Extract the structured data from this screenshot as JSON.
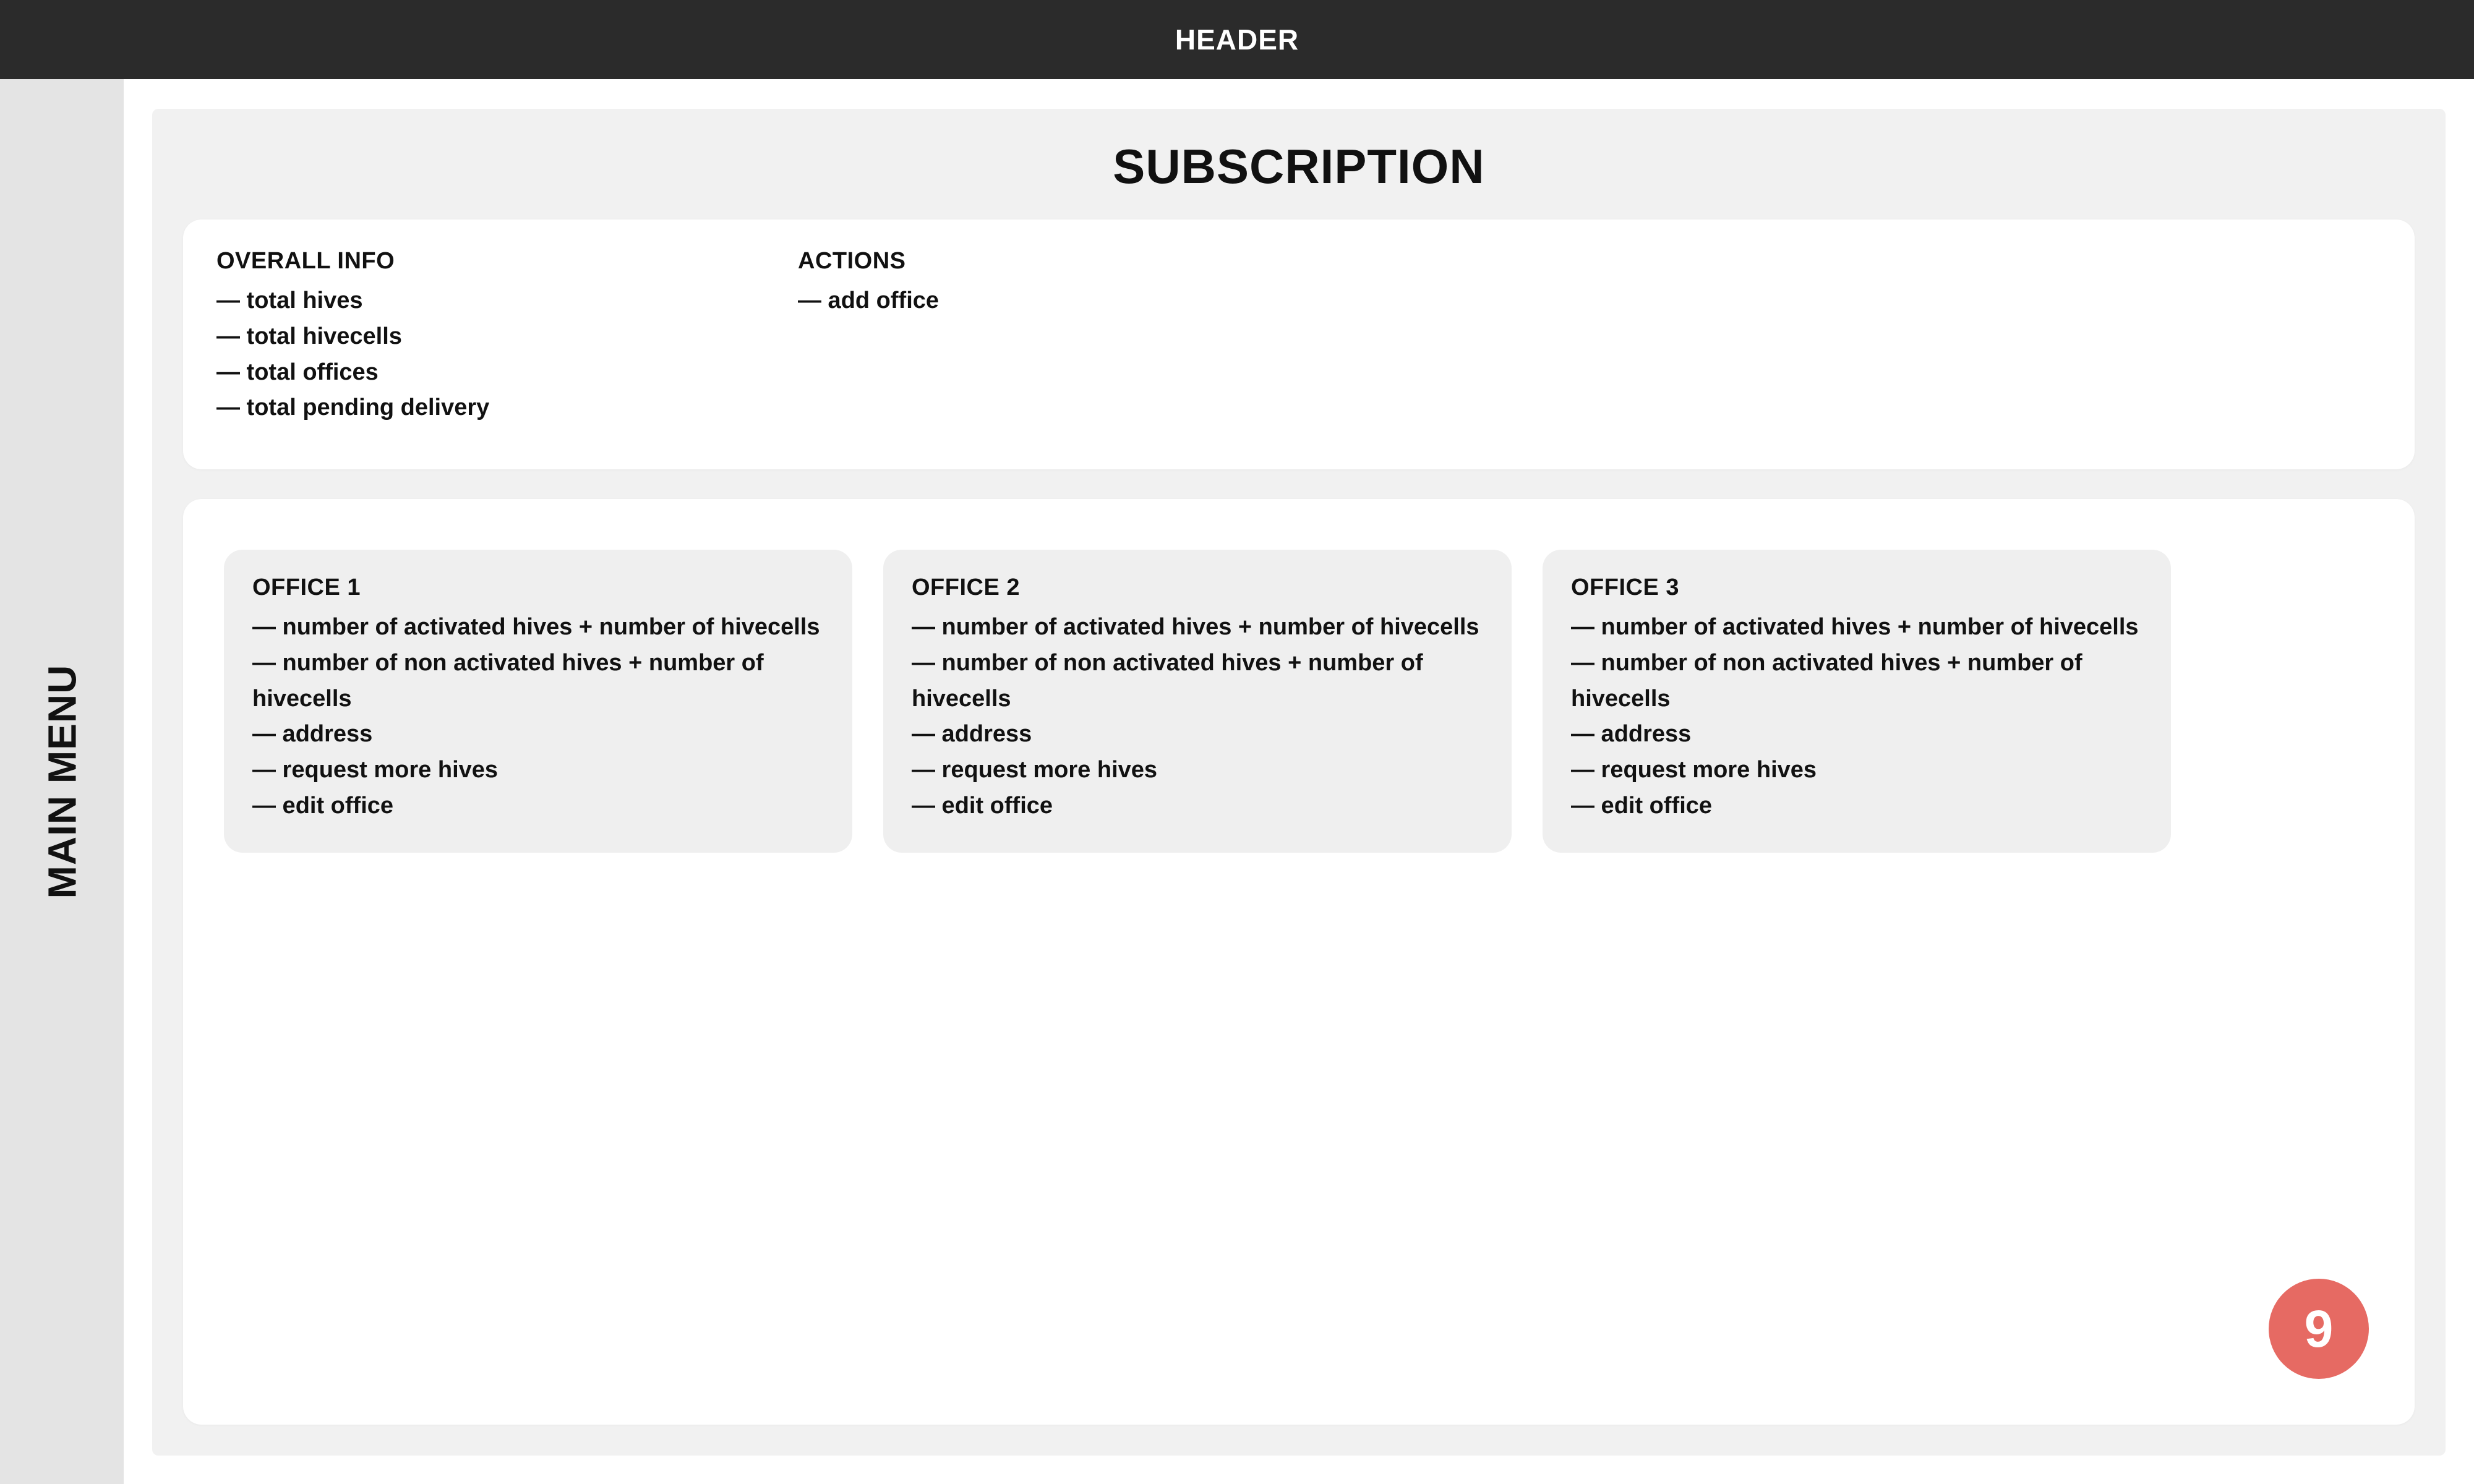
{
  "header": {
    "title": "HEADER"
  },
  "sidebar": {
    "label": "MAIN MENU"
  },
  "page": {
    "title": "SUBSCRIPTION"
  },
  "summary": {
    "overall_info_heading": "OVERALL INFO",
    "overall_items": [
      "— total hives",
      "— total hivecells",
      "— total offices",
      "— total pending delivery"
    ],
    "actions_heading": "ACTIONS",
    "action_items": [
      "— add office"
    ]
  },
  "offices": [
    {
      "title": "OFFICE 1",
      "lines": [
        "— number of activated hives + number of hivecells",
        "— number of non activated hives + number of hivecells",
        "— address",
        "— request more hives",
        "— edit office"
      ]
    },
    {
      "title": "OFFICE 2",
      "lines": [
        "— number of activated hives + number of hivecells",
        "— number of non activated hives + number of hivecells",
        "— address",
        "— request more hives",
        "— edit office"
      ]
    },
    {
      "title": "OFFICE 3",
      "lines": [
        "— number of activated hives + number of hivecells",
        "— number of non activated hives + number of hivecells",
        "— address",
        "— request more hives",
        "— edit office"
      ]
    }
  ],
  "badge": {
    "value": "9"
  }
}
